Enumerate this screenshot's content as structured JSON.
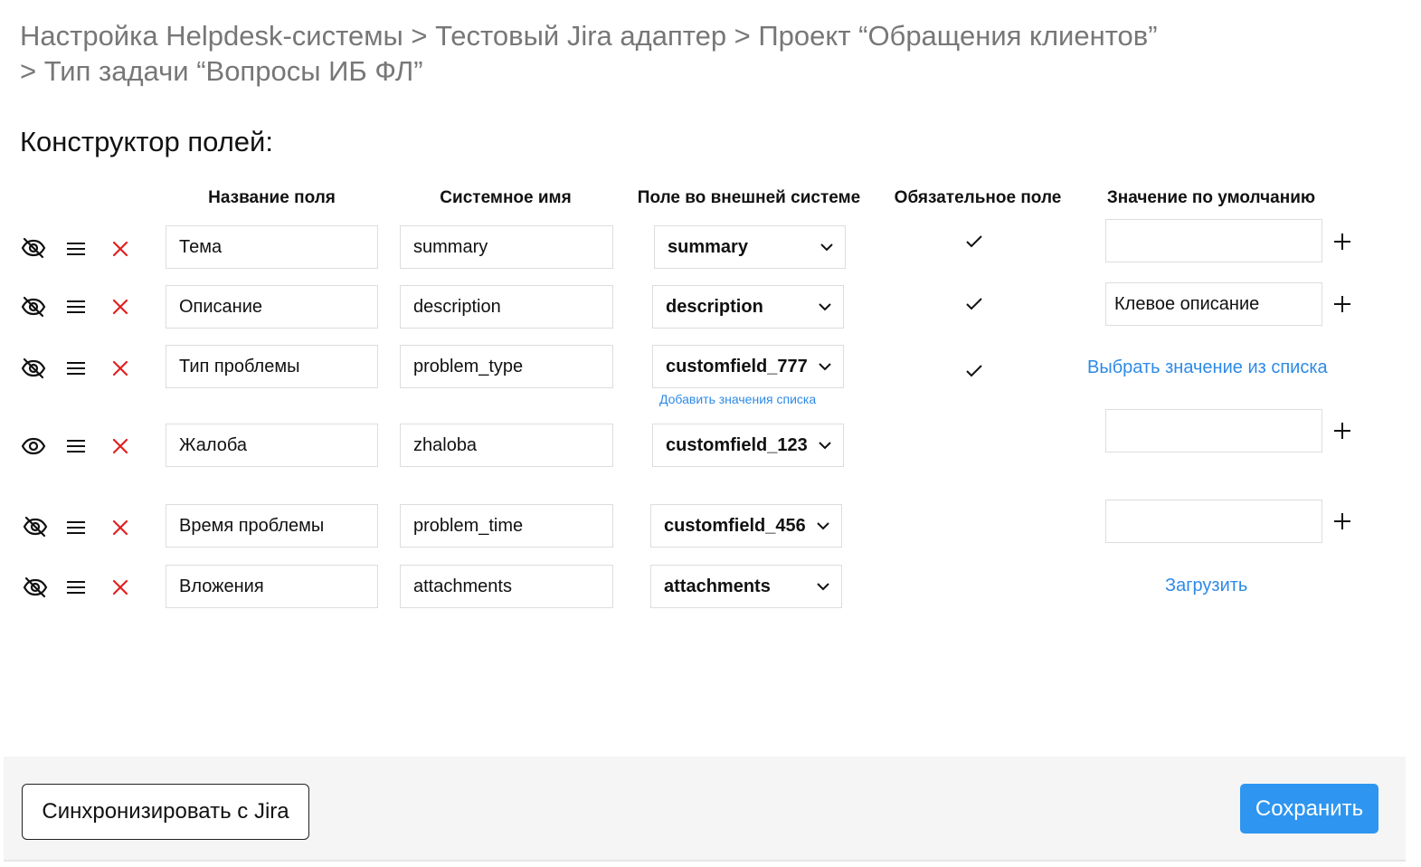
{
  "breadcrumb": {
    "line1": "Настройка Helpdesk-системы > Тестовый Jira адаптер > Проект “Обращения клиентов”",
    "line2": "> Тип задачи “Вопросы ИБ ФЛ”"
  },
  "section_title": "Конструктор полей:",
  "columns": {
    "field_name": "Название поля",
    "system_name": "Системное имя",
    "external_field": "Поле во внешней системе",
    "required": "Обязательное поле",
    "default_value": "Значение по умолчанию"
  },
  "rows": [
    {
      "visibility_icon": "eye-off-icon",
      "name": "Тема",
      "system_name": "summary",
      "external_field": "summary",
      "required": true,
      "default_value": ""
    },
    {
      "visibility_icon": "eye-off-icon",
      "name": "Описание",
      "system_name": "description",
      "external_field": "description",
      "required": true,
      "default_value": "Клевое описание"
    },
    {
      "visibility_icon": "eye-off-icon",
      "name": "Тип проблемы",
      "system_name": "problem_type",
      "external_field": "customfield_777",
      "external_field_link": "Добавить значения списка",
      "required": true,
      "default_link": "Выбрать значение из списка"
    },
    {
      "visibility_icon": "eye-icon",
      "name": "Жалоба",
      "system_name": "zhaloba",
      "external_field": "customfield_123",
      "required": false,
      "default_value": ""
    },
    {
      "visibility_icon": "eye-off-icon",
      "name": "Время проблемы",
      "system_name": "problem_time",
      "external_field": "customfield_456",
      "required": false,
      "default_value": ""
    },
    {
      "visibility_icon": "eye-off-icon",
      "name": "Вложения",
      "system_name": "attachments",
      "external_field": "attachments",
      "required": false,
      "default_link": "Загрузить"
    }
  ],
  "footer": {
    "sync_label": "Синхронизировать с Jira",
    "save_label": "Сохранить"
  },
  "colors": {
    "accent": "#2e96f0",
    "link": "#2e8ae6",
    "delete": "#e02020",
    "muted_text": "#777777"
  }
}
